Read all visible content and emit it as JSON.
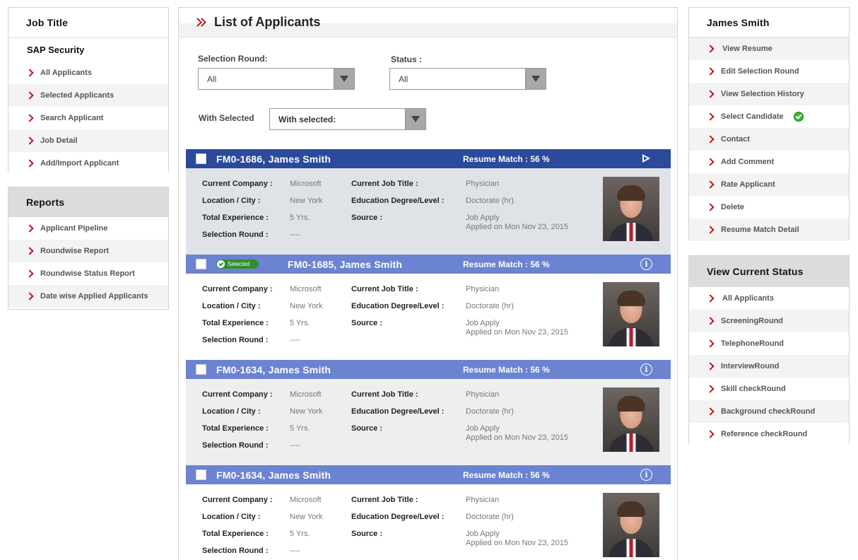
{
  "left": {
    "job_title_heading": "Job Title",
    "job_name": "SAP Security",
    "job_items": [
      {
        "label": "All Applicants"
      },
      {
        "label": "Selected Applicants"
      },
      {
        "label": "Search Applicant"
      },
      {
        "label": "Job Detail"
      },
      {
        "label": "Add/Import Applicant"
      }
    ],
    "reports_heading": "Reports",
    "report_items": [
      {
        "label": "Applicant Pipeline"
      },
      {
        "label": "Roundwise Report"
      },
      {
        "label": "Roundwise Status Report"
      },
      {
        "label": "Date wise Applied Applicants"
      }
    ]
  },
  "main": {
    "title": "List of Applicants",
    "selection_round_label": "Selection Round:",
    "selection_round_value": "All",
    "status_label": "Status :",
    "status_value": "All",
    "with_selected_label": "With Selected",
    "with_selected_value": "With selected:",
    "field_labels": {
      "company": "Current Company :",
      "location": "Location / City :",
      "experience": "Total Experience :",
      "round": "Selection Round :",
      "job_title": "Current Job Title :",
      "education": "Education Degree/Level :",
      "source": "Source :"
    },
    "applicants": [
      {
        "title": "FM0-1686, James Smith",
        "match": "Resume Match : 56 %",
        "company": "Microsoft",
        "location": "New York",
        "experience": "5 Yrs.",
        "round": "----",
        "job_title": "Physician",
        "education": "Doctorate (hr)",
        "source": "Job Apply",
        "applied": "Applied on Mon Nov 23, 2015"
      },
      {
        "title": "FM0-1685, James Smith",
        "badge": "Selected",
        "match": "Resume Match : 56 %",
        "company": "Microsoft",
        "location": "New York",
        "experience": "5 Yrs.",
        "round": "----",
        "job_title": "Physician",
        "education": "Doctorate (hr)",
        "source": "Job Apply",
        "applied": "Applied on Mon Nov 23, 2015"
      },
      {
        "title": "FM0-1634, James Smith",
        "match": "Resume Match : 56 %",
        "company": "Microsoft",
        "location": "New York",
        "experience": "5 Yrs.",
        "round": "----",
        "job_title": "Physician",
        "education": "Doctorate (hr)",
        "source": "Job Apply",
        "applied": "Applied on Mon Nov 23, 2015"
      },
      {
        "title": "FM0-1634, James Smith",
        "match": "Resume Match : 56 %",
        "company": "Microsoft",
        "location": "New York",
        "experience": "5 Yrs.",
        "round": "----",
        "job_title": "Physician",
        "education": "Doctorate (hr)",
        "source": "Job Apply",
        "applied": "Applied on Mon Nov 23, 2015"
      }
    ]
  },
  "right": {
    "candidate_name": "James Smith",
    "actions": [
      {
        "label": "View Resume"
      },
      {
        "label": "Edit Selection Round"
      },
      {
        "label": "View Selection History"
      },
      {
        "label": "Select Candidate"
      },
      {
        "label": "Contact"
      },
      {
        "label": "Add Comment"
      },
      {
        "label": "Rate Applicant"
      },
      {
        "label": "Delete"
      },
      {
        "label": "Resume Match Detail"
      }
    ],
    "status_heading": "View Current Status",
    "status_items": [
      {
        "label": "All Applicants"
      },
      {
        "label": "ScreeningRound"
      },
      {
        "label": "TelephoneRound"
      },
      {
        "label": "InterviewRound"
      },
      {
        "label": "Skill checkRound"
      },
      {
        "label": "Background checkRound"
      },
      {
        "label": "Reference checkRound"
      }
    ]
  },
  "colors": {
    "accent_red": "#c1121c",
    "bar_dark_blue": "#2b4a9c",
    "bar_light_blue": "#6b83d1",
    "selected_green": "#2f8f2f"
  }
}
